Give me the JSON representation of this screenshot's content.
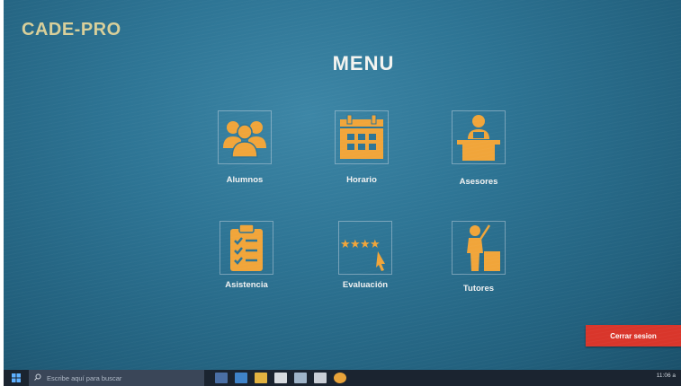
{
  "app": {
    "title": "CADE-PRO"
  },
  "menu": {
    "title": "MENU",
    "items": [
      {
        "id": "alumnos",
        "label": "Alumnos",
        "icon": "students-group-icon"
      },
      {
        "id": "horario",
        "label": "Horario",
        "icon": "calendar-icon"
      },
      {
        "id": "asesores",
        "label": "Asesores",
        "icon": "advisor-desk-icon"
      },
      {
        "id": "asistencia",
        "label": "Asistencia",
        "icon": "clipboard-checklist-icon"
      },
      {
        "id": "evaluacion",
        "label": "Evaluación",
        "icon": "star-rating-icon"
      },
      {
        "id": "tutores",
        "label": "Tutores",
        "icon": "teacher-pointer-icon"
      }
    ]
  },
  "logout": {
    "label": "Cerrar sesion"
  },
  "taskbar": {
    "search_placeholder": "Escribe aquí para buscar",
    "clock": "11:06 a"
  },
  "colors": {
    "icon": "#f1a53a",
    "logout": "#d9362b"
  }
}
